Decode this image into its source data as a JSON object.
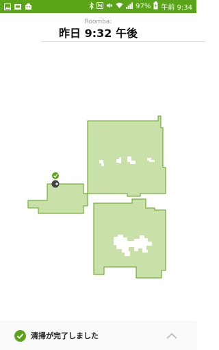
{
  "status_bar": {
    "battery_percent": "97%",
    "time": "午前 9:34",
    "left_icons": [
      "gallery-icon",
      "image-icon",
      "robot-icon"
    ],
    "right_icons": [
      "bluetooth-icon",
      "nfc-icon",
      "mute-icon",
      "wifi-icon",
      "signal-icon",
      "battery-icon"
    ]
  },
  "header": {
    "subtitle": "Roomba:",
    "title": "昨日 9:32 午後"
  },
  "map": {
    "fill_color": "#c9e0a8",
    "edge_color": "#5aa317",
    "robot_color": "#444444",
    "dock_check_color": "#59a418"
  },
  "footer": {
    "status_text": "清掃が完了しました",
    "status_icon": "check-circle-icon",
    "expand_icon": "chevron-up-icon"
  },
  "colors": {
    "accent": "#59a418"
  }
}
